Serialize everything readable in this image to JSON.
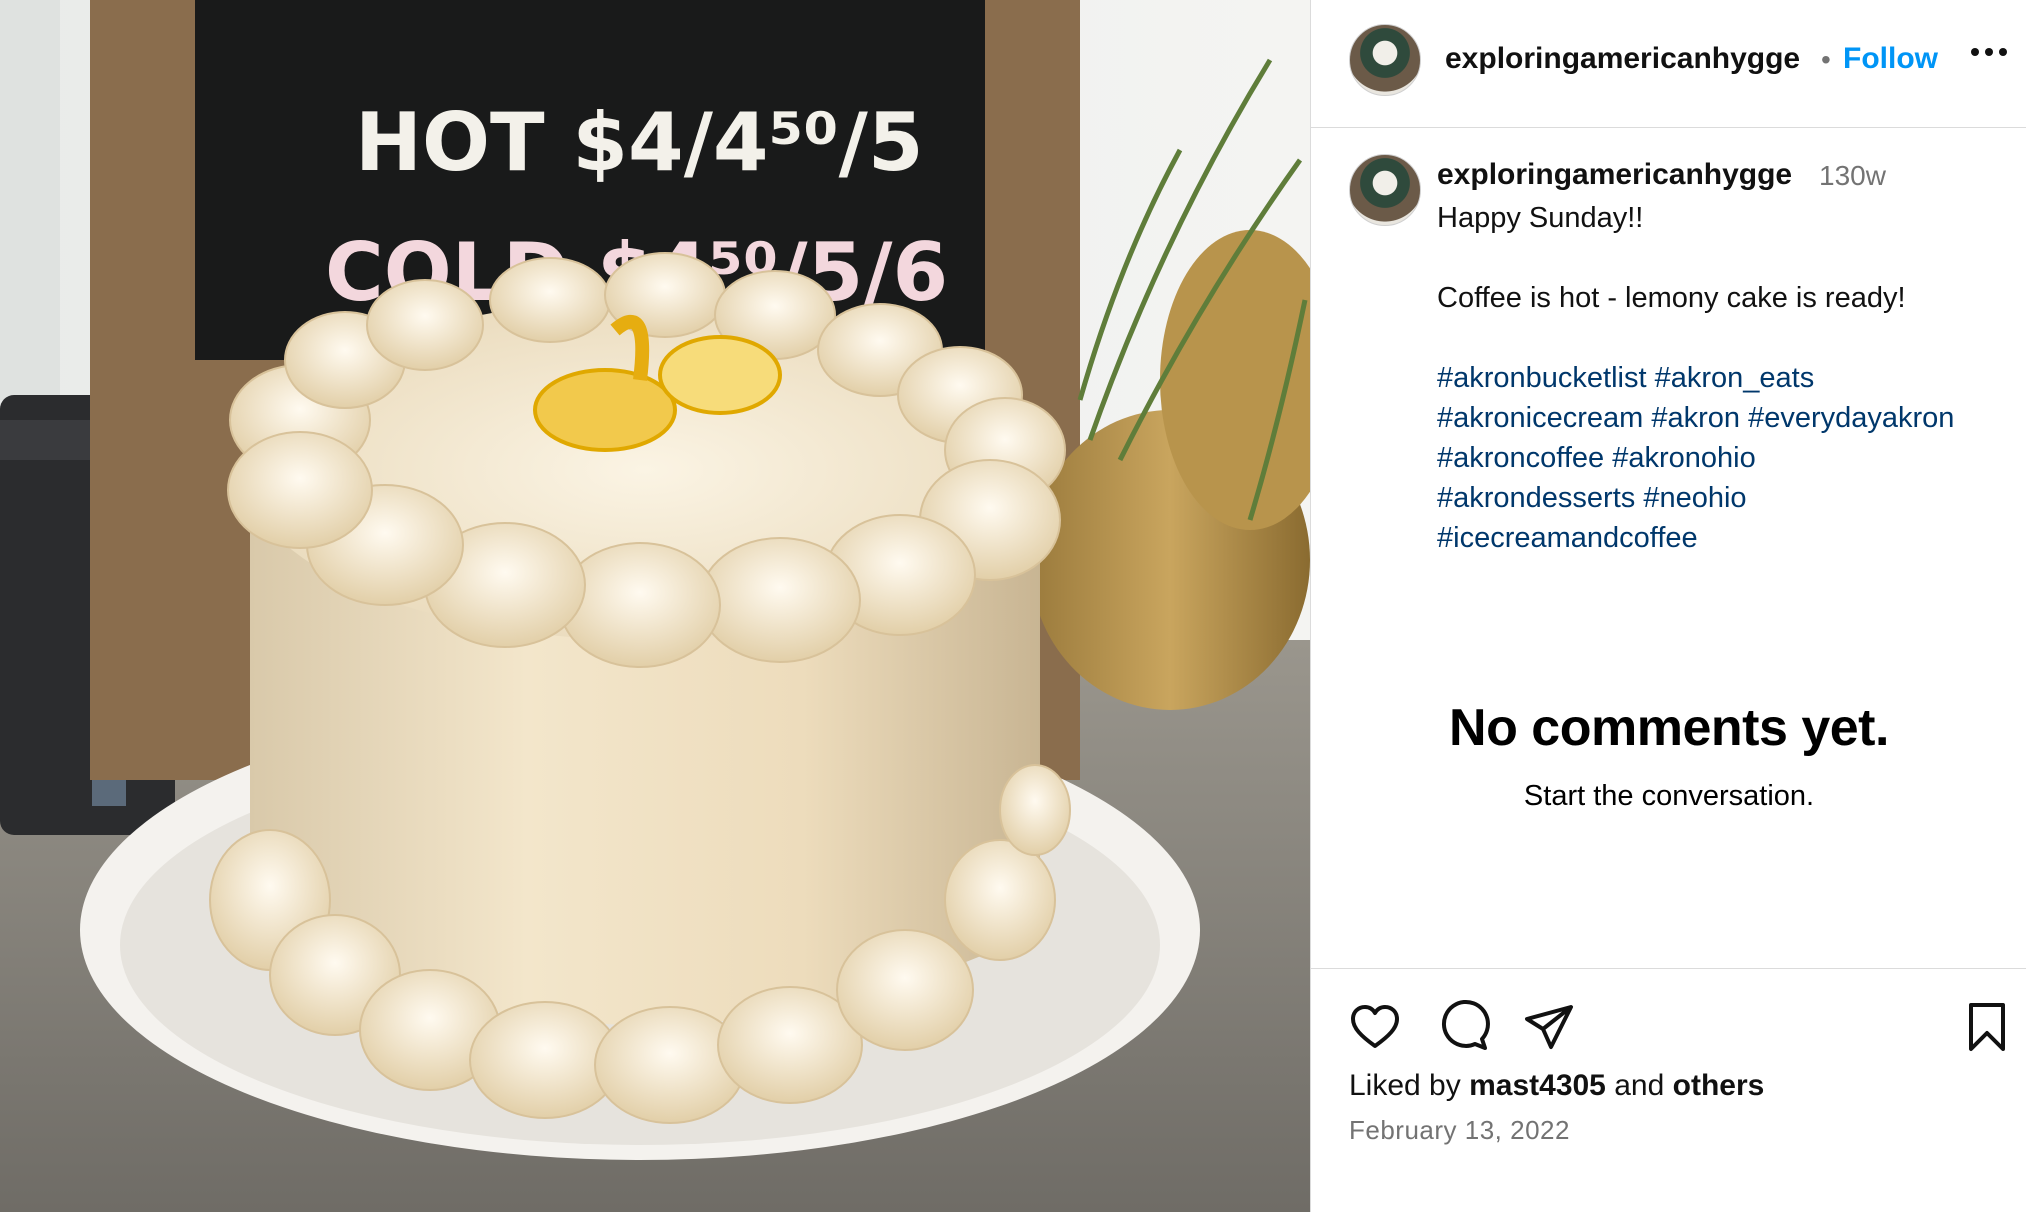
{
  "post": {
    "username": "exploringamericanhygge",
    "follow_label": "Follow",
    "separator": "•"
  },
  "photo": {
    "board_line1": "HOT  $4/4⁵⁰/5",
    "board_line2": "COLD  $4⁵⁰/5/6"
  },
  "caption": {
    "username": "exploringamericanhygge",
    "time_ago": "130w",
    "line1": "Happy Sunday!!",
    "line2": "Coffee is hot - lemony cake is ready!",
    "hashtags": [
      "#akronbucketlist #akron_eats",
      "#akronicecream #akron #everydayakron",
      "#akroncoffee #akronohio",
      "#akrondesserts #neohio",
      "#icecreamandcoffee"
    ]
  },
  "comments": {
    "empty_title": "No comments yet.",
    "empty_subtitle": "Start the conversation."
  },
  "footer": {
    "liked_prefix": "Liked by",
    "liked_user": "mast4305",
    "liked_and": "and",
    "liked_others": "others",
    "date": "February 13, 2022"
  },
  "icons": {
    "like": "heart-icon",
    "comment": "comment-icon",
    "share": "share-icon",
    "save": "bookmark-icon",
    "more": "more-icon"
  },
  "colors": {
    "link_blue": "#0095f6",
    "hashtag": "#00376b",
    "muted": "#737373",
    "divider": "#dbdbdb"
  }
}
